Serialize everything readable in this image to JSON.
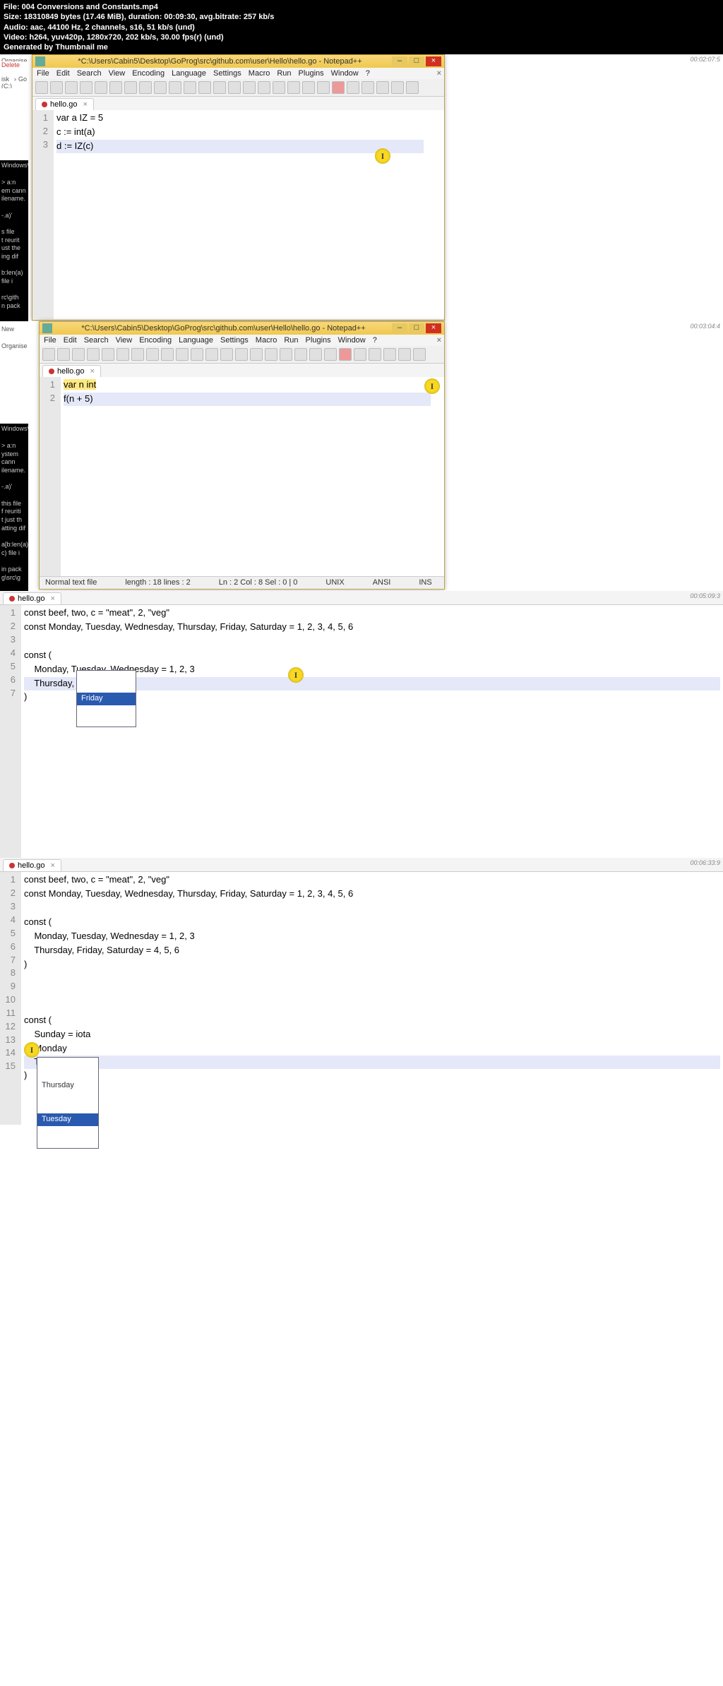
{
  "header": {
    "file": "File: 004 Conversions and Constants.mp4",
    "size": "Size: 18310849 bytes (17.46 MiB), duration: 00:09:30, avg.bitrate: 257 kb/s",
    "audio": "Audio: aac, 44100 Hz, 2 channels, s16, 51 kb/s (und)",
    "video": "Video: h264, yuv420p, 1280x720, 202 kb/s, 30.00 fps(r) (und)",
    "gen": "Generated by Thumbnail me"
  },
  "win1": {
    "title": "*C:\\Users\\Cabin5\\Desktop\\GoProg\\src\\github.com\\user\\Hello\\hello.go - Notepad++",
    "menu": [
      "File",
      "Edit",
      "Search",
      "View",
      "Encoding",
      "Language",
      "Settings",
      "Macro",
      "Run",
      "Plugins",
      "Window",
      "?"
    ],
    "tab": "hello.go",
    "lines": [
      "1",
      "2",
      "3"
    ],
    "code1": "var a IZ = 5",
    "code2": "c := int(a)",
    "code3": "d := IZ(c)",
    "crumb_disk": "isk (C:)",
    "crumb_go": "Go",
    "crumb_prog": "",
    "ts": "00:02:07:5"
  },
  "win2": {
    "title": "*C:\\Users\\Cabin5\\Desktop\\GoProg\\src\\github.com\\user\\Hello\\hello.go - Notepad++",
    "menu": [
      "File",
      "Edit",
      "Search",
      "View",
      "Encoding",
      "Language",
      "Settings",
      "Macro",
      "Run",
      "Plugins",
      "Window",
      "?"
    ],
    "tab": "hello.go",
    "lines": [
      "1",
      "2"
    ],
    "code1": "var n int",
    "code2": "f(n + 5)",
    "status": {
      "type": "Normal text file",
      "len": "length : 18   lines : 2",
      "pos": "Ln : 2   Col : 8   Sel : 0 | 0",
      "eol": "UNIX",
      "enc": "ANSI",
      "mode": "INS"
    },
    "ts": "00:03:04:4"
  },
  "panel3": {
    "tab": "hello.go",
    "lines": [
      "1",
      "2",
      "3",
      "4",
      "5",
      "6",
      "7"
    ],
    "c1": "const beef, two, c = \"meat\", 2, \"veg\"",
    "c2": "const Monday, Tuesday, Wednesday, Thursday, Friday, Saturday = 1, 2, 3, 4, 5, 6",
    "c3": "",
    "c4": "const (",
    "c5": "    Monday, Tuesday, Wednesday = 1, 2, 3",
    "c6": "    Thursday, F",
    "c7": ")",
    "autoc": "Friday",
    "ts": "00:05:09:3"
  },
  "panel4": {
    "tab": "hello.go",
    "lines": [
      "1",
      "2",
      "3",
      "4",
      "5",
      "6",
      "7",
      "8",
      "9",
      "10",
      "11",
      "12",
      "13",
      "14",
      "15"
    ],
    "c1": "const beef, two, c = \"meat\", 2, \"veg\"",
    "c2": "const Monday, Tuesday, Wednesday, Thursday, Friday, Saturday = 1, 2, 3, 4, 5, 6",
    "c3": "",
    "c4": "const (",
    "c5": "    Monday, Tuesday, Wednesday = 1, 2, 3",
    "c6": "    Thursday, Friday, Saturday = 4, 5, 6",
    "c7": ")",
    "c8": "",
    "c9": "",
    "c10": "",
    "c11": "const (",
    "c12": "    Sunday = iota",
    "c13": "    Monday",
    "c14": "    Tu",
    "c15": ")",
    "ac1": "Thursday",
    "ac2": "Tuesday",
    "ts": "00:06:33:9"
  },
  "termfrag": [
    "Windows\\s",
    "> a:n",
    "em cann",
    "ilename.",
    "-.a)'",
    "s file",
    "t reurit",
    "ust the",
    "ing dif",
    "b:len(a)",
    "file i",
    "rc\\gith",
    "n pack",
    "g\\src\\g"
  ],
  "explorer": {
    "organise": "Organise",
    "new": "New",
    "delete": "Delete"
  }
}
